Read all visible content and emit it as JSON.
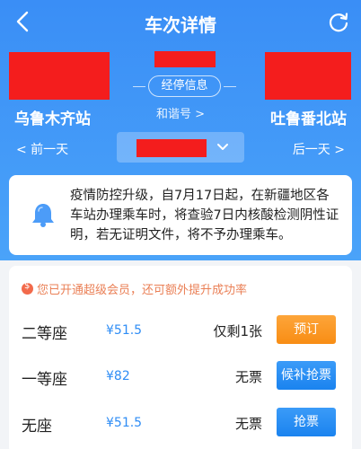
{
  "header": {
    "title": "车次详情",
    "from_station": "乌鲁木齐站",
    "to_station": "吐鲁番北站",
    "stop_info_label": "经停信息",
    "train_name": "和谐号 >",
    "prev_day": "< 前一天",
    "next_day": "后一天 >"
  },
  "notice": {
    "text": "疫情防控升级，自7月17日起，在新疆地区各车站办理乘车时，将查验7日内核酸检测阴性证明，若无证明文件，将不予办理乘车。"
  },
  "vip": {
    "text": "您已开通超级会员，还可额外提升成功率"
  },
  "seats": [
    {
      "name": "二等座",
      "price": "¥51.5",
      "status": "仅剩1张",
      "button": "预订"
    },
    {
      "name": "一等座",
      "price": "¥82",
      "status": "无票",
      "button": "候补抢票"
    },
    {
      "name": "无座",
      "price": "¥51.5",
      "status": "无票",
      "button": "抢票"
    }
  ],
  "colors": {
    "header_blue": "#3a8ef6",
    "redaction": "#f41d1d",
    "book_orange": "#f88d14",
    "action_blue": "#1a83ef",
    "price_blue": "#2f8df5",
    "vip_orange": "#ea7f55"
  },
  "icons": [
    "back-icon",
    "refresh-icon",
    "chevron-down-icon",
    "bell-icon",
    "vip-icon"
  ]
}
